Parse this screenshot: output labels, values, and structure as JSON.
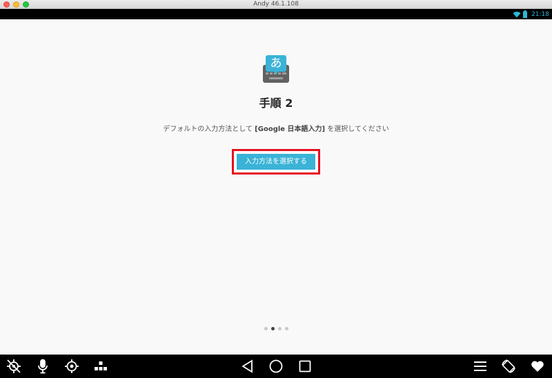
{
  "window": {
    "title": "Andy 46.1.108"
  },
  "statusbar": {
    "clock": "21:18",
    "icons": [
      "wifi-icon",
      "battery-icon"
    ],
    "clock_color": "#2bb8d6"
  },
  "main": {
    "icon": "google-japanese-input-keyboard-icon",
    "icon_glyph": "あ",
    "title": "手順 2",
    "description_prefix": "デフォルトの入力方法として ",
    "description_strong": "[Google 日本語入力]",
    "description_suffix": " を選択してください",
    "button_label": "入力方法を選択する",
    "accent_color": "#3ab3d7",
    "highlight_color": "#e6101f"
  },
  "pager": {
    "count": 4,
    "active_index": 1
  },
  "navbar": {
    "left_icons": [
      "location-off-icon",
      "microphone-icon",
      "gps-target-icon",
      "keymap-icon"
    ],
    "center_icons": [
      "back-triangle-icon",
      "home-circle-icon",
      "recents-square-icon"
    ],
    "right_icons": [
      "menu-icon",
      "rotate-screen-icon",
      "heart-icon"
    ]
  }
}
